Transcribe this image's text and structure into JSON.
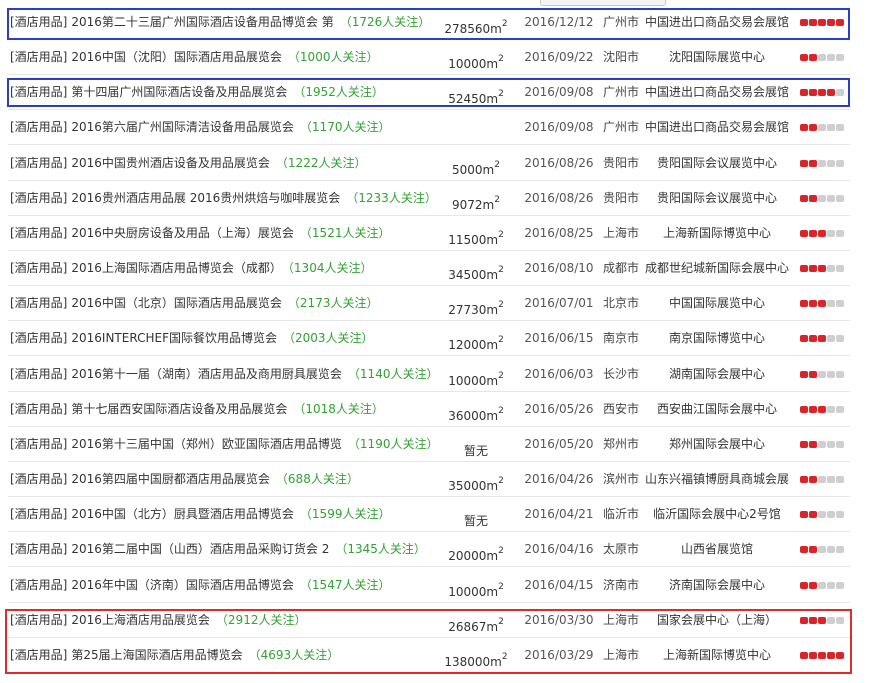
{
  "rows": [
    {
      "category": "[酒店用品]",
      "name": "2016第二十三届广州国际酒店设备用品博览会 第",
      "attention": "（1726人关注）",
      "area": "278560m",
      "area_sup": "2",
      "date": "2016/12/12",
      "city": "广州市",
      "venue": "中国进出口商品交易会展馆",
      "rating": 5
    },
    {
      "category": "[酒店用品]",
      "name": "2016中国（沈阳）国际酒店用品展览会",
      "attention": "（1000人关注）",
      "area": "10000m",
      "area_sup": "2",
      "date": "2016/09/22",
      "city": "沈阳市",
      "venue": "沈阳国际展览中心",
      "rating": 2
    },
    {
      "category": "[酒店用品]",
      "name": "第十四届广州国际酒店设备及用品展览会",
      "attention": "（1952人关注）",
      "area": "52450m",
      "area_sup": "2",
      "date": "2016/09/08",
      "city": "广州市",
      "venue": "中国进出口商品交易会展馆",
      "rating": 4
    },
    {
      "category": "[酒店用品]",
      "name": "2016第六届广州国际清洁设备用品展览会",
      "attention": "（1170人关注）",
      "area": "",
      "area_sup": "",
      "date": "2016/09/08",
      "city": "广州市",
      "venue": "中国进出口商品交易会展馆",
      "rating": 2
    },
    {
      "category": "[酒店用品]",
      "name": "2016中国贵州酒店设备及用品展览会",
      "attention": "（1222人关注）",
      "area": "5000m",
      "area_sup": "2",
      "date": "2016/08/26",
      "city": "贵阳市",
      "venue": "贵阳国际会议展览中心",
      "rating": 2
    },
    {
      "category": "[酒店用品]",
      "name": "2016贵州酒店用品展 2016贵州烘焙与咖啡展览会",
      "attention": "（1233人关注）",
      "area": "9072m",
      "area_sup": "2",
      "date": "2016/08/26",
      "city": "贵阳市",
      "venue": "贵阳国际会议展览中心",
      "rating": 2
    },
    {
      "category": "[酒店用品]",
      "name": "2016中央厨房设备及用品（上海）展览会",
      "attention": "（1521人关注）",
      "area": "11500m",
      "area_sup": "2",
      "date": "2016/08/25",
      "city": "上海市",
      "venue": "上海新国际博览中心",
      "rating": 3
    },
    {
      "category": "[酒店用品]",
      "name": "2016上海国际酒店用品博览会（成都）",
      "attention": "（1304人关注）",
      "area": "34500m",
      "area_sup": "2",
      "date": "2016/08/10",
      "city": "成都市",
      "venue": "成都世纪城新国际会展中心",
      "rating": 3
    },
    {
      "category": "[酒店用品]",
      "name": "2016中国（北京）国际酒店用品展览会",
      "attention": "（2173人关注）",
      "area": "27730m",
      "area_sup": "2",
      "date": "2016/07/01",
      "city": "北京市",
      "venue": "中国国际展览中心",
      "rating": 3
    },
    {
      "category": "[酒店用品]",
      "name": "2016INTERCHEF国际餐饮用品博览会",
      "attention": "（2003人关注）",
      "area": "12000m",
      "area_sup": "2",
      "date": "2016/06/15",
      "city": "南京市",
      "venue": "南京国际博览中心",
      "rating": 3
    },
    {
      "category": "[酒店用品]",
      "name": "2016第十一届（湖南）酒店用品及商用厨具展览会",
      "attention": "（1140人关注）",
      "area": "10000m",
      "area_sup": "2",
      "date": "2016/06/03",
      "city": "长沙市",
      "venue": "湖南国际会展中心",
      "rating": 2
    },
    {
      "category": "[酒店用品]",
      "name": "第十七届西安国际酒店设备及用品展览会",
      "attention": "（1018人关注）",
      "area": "36000m",
      "area_sup": "2",
      "date": "2016/05/26",
      "city": "西安市",
      "venue": "西安曲江国际会展中心",
      "rating": 3
    },
    {
      "category": "[酒店用品]",
      "name": "2016第十三届中国（郑州）欧亚国际酒店用品博览",
      "attention": "（1190人关注）",
      "area": "暂无",
      "area_sup": "",
      "date": "2016/05/20",
      "city": "郑州市",
      "venue": "郑州国际会展中心",
      "rating": 2
    },
    {
      "category": "[酒店用品]",
      "name": "2016第四届中国厨都酒店用品展览会",
      "attention": "（688人关注）",
      "area": "35000m",
      "area_sup": "2",
      "date": "2016/04/26",
      "city": "滨州市",
      "venue": "山东兴福镇博厨具商城会展",
      "rating": 2
    },
    {
      "category": "[酒店用品]",
      "name": "2016中国（北方）厨具暨酒店用品博览会",
      "attention": "（1599人关注）",
      "area": "暂无",
      "area_sup": "",
      "date": "2016/04/21",
      "city": "临沂市",
      "venue": "临沂国际会展中心2号馆",
      "rating": 2
    },
    {
      "category": "[酒店用品]",
      "name": "2016第二届中国（山西）酒店用品采购订货会 2",
      "attention": "（1345人关注）",
      "area": "20000m",
      "area_sup": "2",
      "date": "2016/04/16",
      "city": "太原市",
      "venue": "山西省展览馆",
      "rating": 2
    },
    {
      "category": "[酒店用品]",
      "name": "2016年中国（济南）国际酒店用品博览会",
      "attention": "（1547人关注）",
      "area": "10000m",
      "area_sup": "2",
      "date": "2016/04/15",
      "city": "济南市",
      "venue": "济南国际会展中心",
      "rating": 2
    },
    {
      "category": "[酒店用品]",
      "name": "2016上海酒店用品展览会",
      "attention": "（2912人关注）",
      "area": "26867m",
      "area_sup": "2",
      "date": "2016/03/30",
      "city": "上海市",
      "venue": "国家会展中心（上海）",
      "rating": 3
    },
    {
      "category": "[酒店用品]",
      "name": "第25届上海国际酒店用品博览会",
      "attention": "（4693人关注）",
      "area": "138000m",
      "area_sup": "2",
      "date": "2016/03/29",
      "city": "上海市",
      "venue": "上海新国际博览中心",
      "rating": 5
    }
  ],
  "colors": {
    "highlight_blue": "#2b3fbf",
    "highlight_red": "#e02b2b",
    "attention_green": "#33a133",
    "star_on": "#d9242a",
    "star_off": "#cfcfcf"
  }
}
